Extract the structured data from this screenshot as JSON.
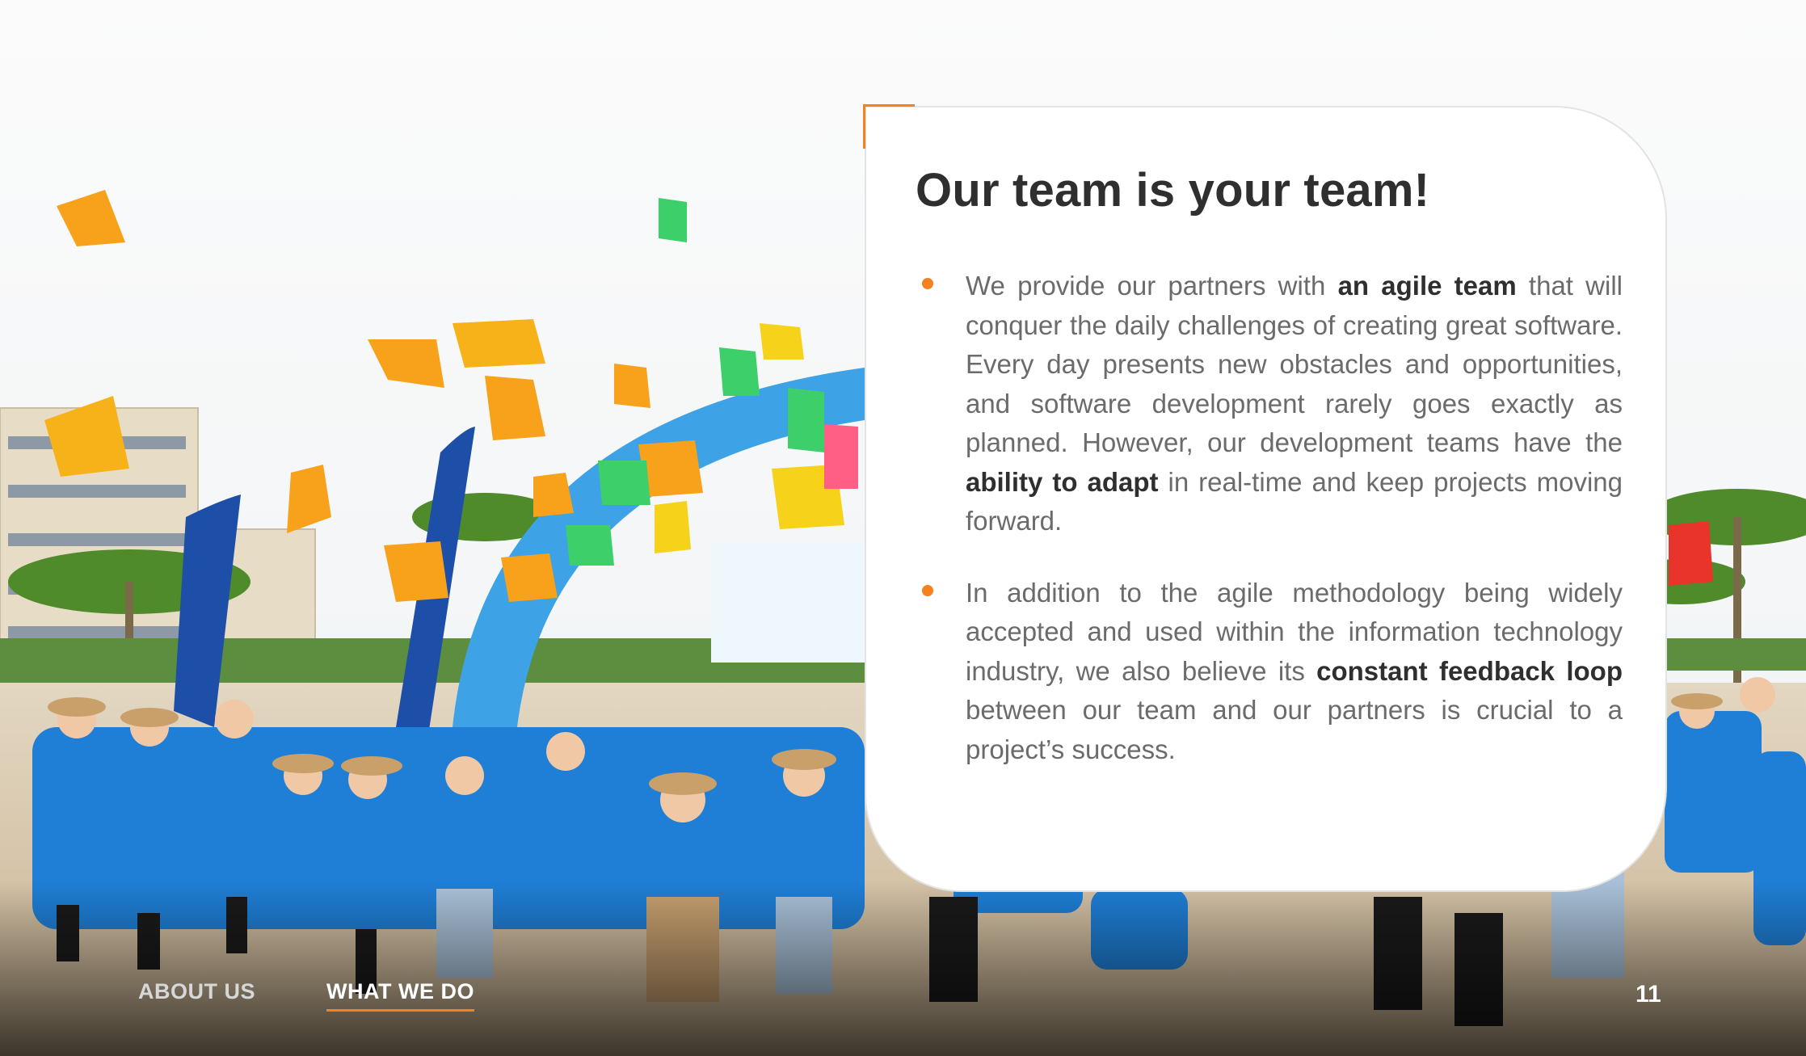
{
  "slide": {
    "title": "Our team is your team!",
    "accent_color": "#f5821f",
    "bullets": [
      {
        "segments": [
          {
            "text": "We provide our partners with ",
            "bold": false
          },
          {
            "text": "an agile team",
            "bold": true
          },
          {
            "text": " that will conquer the daily challenges of creating great software. Every day presents new obstacles and opportunities, and software development rarely goes exactly as planned. However, our development teams have the ",
            "bold": false
          },
          {
            "text": "ability to adapt",
            "bold": true
          },
          {
            "text": " in real-time and keep projects moving forward.",
            "bold": false
          }
        ]
      },
      {
        "segments": [
          {
            "text": "In addition to the agile methodology being widely accepted and used within the information technology industry, we also believe its ",
            "bold": false
          },
          {
            "text": "constant feedback loop",
            "bold": true
          },
          {
            "text": " between our team and our partners is crucial to a project’s success.",
            "bold": false
          }
        ]
      }
    ],
    "page_number": "11"
  },
  "nav": {
    "items": [
      {
        "label": "ABOUT US",
        "active": false
      },
      {
        "label": "WHAT WE DO",
        "active": true
      }
    ]
  },
  "background": {
    "description_icon": "team-beach-photo",
    "colors": {
      "sky": "#f3f6f8",
      "sand": "#d8c8ad",
      "shirt": "#1f7fd6",
      "arch": "#3ea2e6",
      "flag": "#f7a21a"
    }
  }
}
